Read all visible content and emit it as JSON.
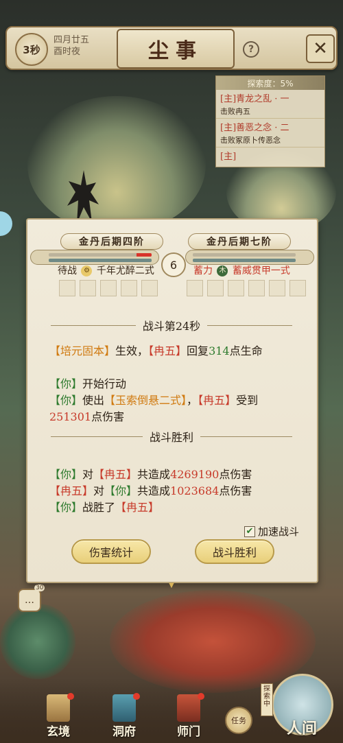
{
  "header": {
    "timer": "3秒",
    "date_line1": "四月廿五",
    "date_line2": "酉时夜",
    "title": "尘事",
    "help": "?",
    "close": "✕"
  },
  "quest_panel": {
    "progress": "探索度：5%",
    "items": [
      {
        "title": "[主]青龙之乱 · 一",
        "desc": "击败冉五"
      },
      {
        "title": "[主]善恶之念 · 二",
        "desc": "击败冢原卜传恶念"
      },
      {
        "title": "[主]",
        "desc": ""
      }
    ]
  },
  "battle": {
    "left_fighter": {
      "name": "金丹后期四阶",
      "hp_fraction": 0.15,
      "status": "待战",
      "skill_badge": "⚙",
      "skill": "千年尤醉二式"
    },
    "right_fighter": {
      "name": "金丹后期七阶",
      "status": "蓄力",
      "skill_badge": "木",
      "skill": "蓄威贯甲一式"
    },
    "round": "6",
    "log": {
      "sep1": "战斗第24秒",
      "l1": {
        "a": "【培元固本】",
        "b": "生效，",
        "c": "【冉五】",
        "d": "回复",
        "e": "314",
        "f": "点生命"
      },
      "l2": {
        "a": "【你】",
        "b": "开始行动"
      },
      "l3": {
        "a": "【你】",
        "b": "使出",
        "c": "【玉索倒悬二式】",
        "d": "，",
        "e": "【冉五】",
        "f": "受到"
      },
      "l4": {
        "a": "251301",
        "b": "点伤害"
      },
      "sep2": "战斗胜利",
      "l5": {
        "a": "【你】",
        "b": "对",
        "c": "【冉五】",
        "d": "共造成",
        "e": "4269190",
        "f": "点伤害"
      },
      "l6": {
        "a": "【冉五】",
        "b": "对",
        "c": "【你】",
        "d": "共造成",
        "e": "1023684",
        "f": "点伤害"
      },
      "l7": {
        "a": "【你】",
        "b": "战胜了",
        "c": "【冉五】"
      }
    },
    "speed_label": "加速战斗",
    "speed_checked": "✔",
    "btn_stats": "伤害统计",
    "btn_victory": "战斗胜利"
  },
  "chat_badge": "30",
  "nav": {
    "items": [
      "玄境",
      "洞府",
      "师门"
    ],
    "mission": "任务",
    "explore": "探索中",
    "world": "人间"
  }
}
